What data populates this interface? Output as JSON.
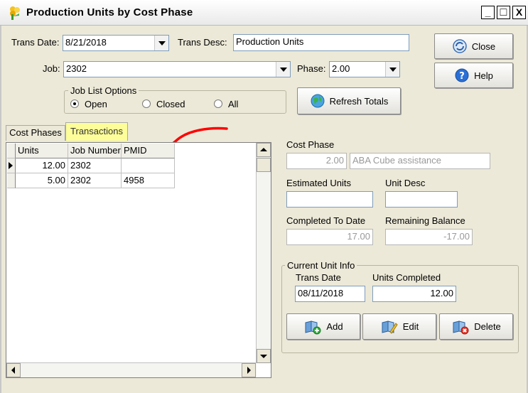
{
  "window": {
    "title": "Production Units by Cost Phase",
    "controls": [
      "_",
      "□",
      "X"
    ]
  },
  "header": {
    "trans_date_label": "Trans Date:",
    "trans_date_value": "8/21/2018",
    "trans_desc_label": "Trans Desc:",
    "trans_desc_value": "Production Units",
    "job_label": "Job:",
    "job_value": "2302",
    "phase_label": "Phase:",
    "phase_value": "2.00"
  },
  "job_list_options": {
    "title": "Job List Options",
    "options": [
      {
        "label": "Open",
        "selected": true
      },
      {
        "label": "Closed",
        "selected": false
      },
      {
        "label": "All",
        "selected": false
      }
    ]
  },
  "buttons": {
    "refresh_totals": "Refresh Totals",
    "close": "Close",
    "help": "Help",
    "add": "Add",
    "edit": "Edit",
    "delete": "Delete"
  },
  "tabs": [
    {
      "label": "Cost Phases",
      "active": false
    },
    {
      "label": "Transactions",
      "active": true
    }
  ],
  "grid": {
    "columns": [
      "Units",
      "Job Number",
      "PMID"
    ],
    "rows": [
      {
        "units": "12.00",
        "job_number": "2302",
        "pmid": "",
        "current": true
      },
      {
        "units": "5.00",
        "job_number": "2302",
        "pmid": "4958",
        "current": false
      }
    ]
  },
  "cost_phase": {
    "label": "Cost Phase",
    "number": "2.00",
    "description": "ABA Cube assistance"
  },
  "estimated_units": {
    "label": "Estimated Units",
    "value": ""
  },
  "unit_desc": {
    "label": "Unit Desc",
    "value": ""
  },
  "completed_to_date": {
    "label": "Completed To Date",
    "value": "17.00"
  },
  "remaining_balance": {
    "label": "Remaining Balance",
    "value": "-17.00"
  },
  "current_unit_info": {
    "title": "Current Unit Info",
    "trans_date_label": "Trans Date",
    "trans_date_value": "08/11/2018",
    "units_completed_label": "Units Completed",
    "units_completed_value": "12.00"
  },
  "colors": {
    "active_tab": "#fdfd99",
    "annotation_arrow": "#ff0000",
    "window_bg": "#ece9d8"
  }
}
